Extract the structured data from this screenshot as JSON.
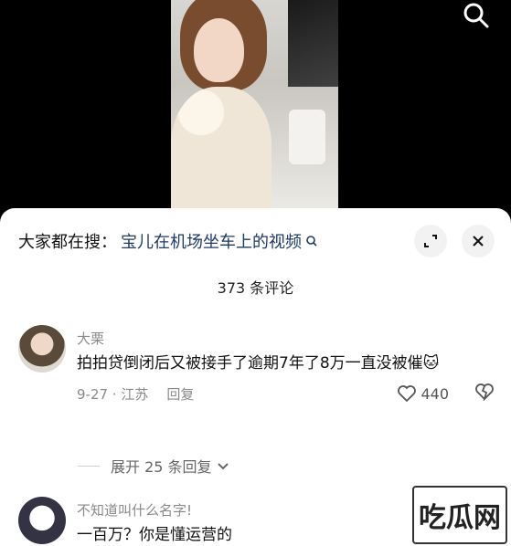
{
  "video": {
    "search_icon": "search-icon"
  },
  "header": {
    "prefix": "大家都在搜：",
    "query": "宝儿在机场坐车上的视频",
    "query_icon": "search-icon",
    "expand_icon": "expand-icon",
    "close_icon": "close-icon"
  },
  "comments_count": "373 条评论",
  "comments": [
    {
      "username": "大栗",
      "text": "拍拍贷倒闭后又被接手了逾期7年了8万一直没被催🐱",
      "date_location": "9-27 · 江苏",
      "reply_label": "回复",
      "likes": "440"
    },
    {
      "username": "不知道叫什么名字!",
      "text": "一百万？你是懂运营的"
    }
  ],
  "expand_replies": "展开 25 条回复",
  "watermark": "吃瓜网"
}
